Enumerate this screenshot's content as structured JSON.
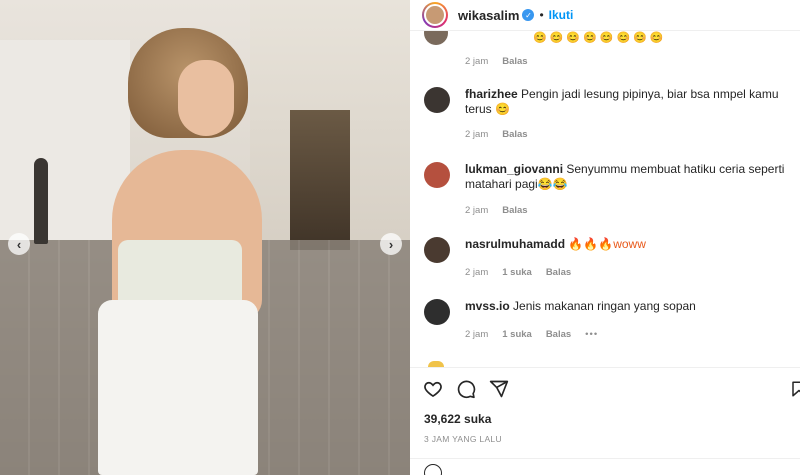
{
  "post": {
    "username": "wikasalim",
    "follow_label": "Ikuti",
    "separator": "•",
    "carousel_prev": "‹",
    "carousel_next": "›"
  },
  "top_partial": {
    "time": "2 jam",
    "reply": "Balas",
    "emojis": "😊😊😊😊😊😊😊😊"
  },
  "comments": [
    {
      "username": "fharizhee",
      "text": "Pengin jadi lesung pipinya, biar bsa nmpel kamu terus 😊",
      "time": "2 jam",
      "likes": "",
      "reply": "Balas",
      "avatar_color": "#3b3531"
    },
    {
      "username": "lukman_giovanni",
      "text": "Senyummu membuat hatiku ceria seperti matahari pagi😂😂",
      "time": "2 jam",
      "likes": "",
      "reply": "Balas",
      "avatar_color": "#b5503e"
    },
    {
      "username": "nasrulmuhamadd",
      "text": "🔥🔥🔥woww",
      "time": "2 jam",
      "likes": "1 suka",
      "reply": "Balas",
      "avatar_color": "#4a3a30"
    },
    {
      "username": "mvss.io",
      "text": "Jenis makanan ringan yang sopan",
      "time": "2 jam",
      "likes": "1 suka",
      "reply": "Balas",
      "more": "•••",
      "avatar_color": "#2e2e2e"
    }
  ],
  "footer": {
    "likes_count": "39,622 suka",
    "time_ago": "3 JAM YANG LALU"
  },
  "icons": [
    "heart-icon",
    "comment-icon",
    "share-icon",
    "bookmark-icon",
    "verified-icon",
    "emoji-icon"
  ],
  "colors": {
    "accent": "#0095f6",
    "verified": "#3897f0",
    "text": "#262626",
    "muted": "#8e8e8e"
  }
}
